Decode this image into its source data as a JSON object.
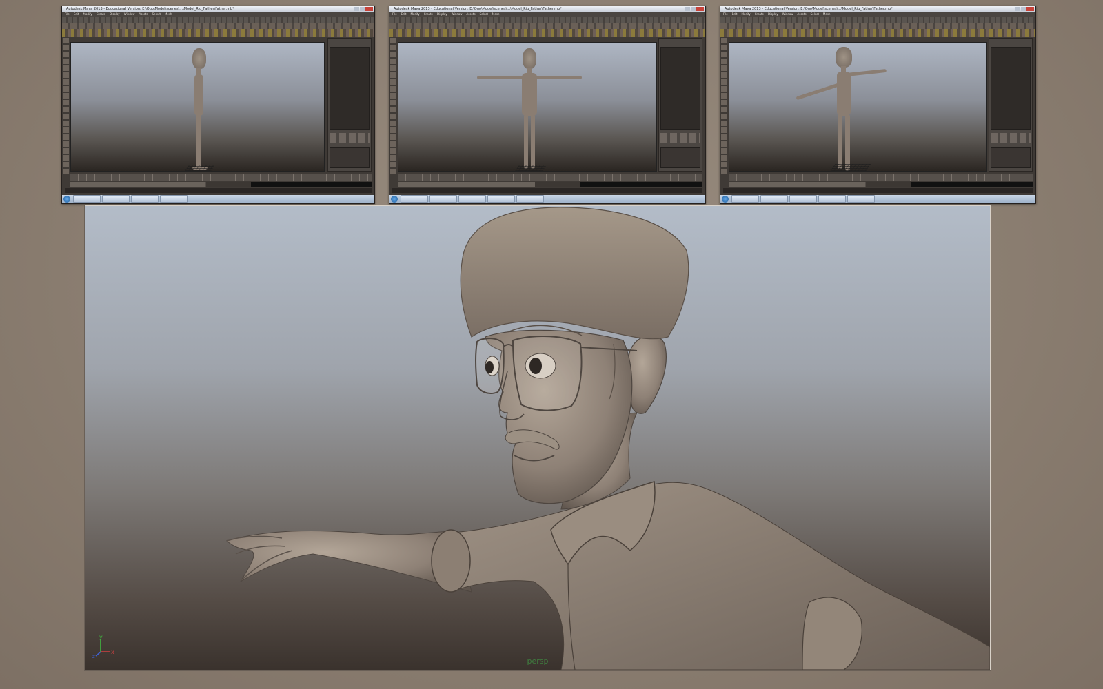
{
  "thumbnails": [
    {
      "title": "Autodesk Maya 2013 - Educational Version: E:\\Ogo\\Model\\scenes\\...\\Model_Rig_Father\\Father.mb*",
      "menu": [
        "File",
        "Edit",
        "Modify",
        "Create",
        "Display",
        "Window",
        "Assets",
        "Select",
        "Mesh",
        "Edit Mesh",
        "Proxy",
        "Normals",
        "Color",
        "Create UVs",
        "Edit UVs",
        "Muscle",
        "Pipeline Cache",
        "Help"
      ],
      "view": "side"
    },
    {
      "title": "Autodesk Maya 2013 - Educational Version: E:\\Ogo\\Model\\scenes\\...\\Model_Rig_Father\\Father.mb*",
      "menu": [
        "File",
        "Edit",
        "Modify",
        "Create",
        "Display",
        "Window",
        "Assets",
        "Select",
        "Mesh",
        "Edit Mesh",
        "Proxy",
        "Normals",
        "Color",
        "Create UVs",
        "Edit UVs",
        "Muscle",
        "Pipeline Cache",
        "Help"
      ],
      "view": "front"
    },
    {
      "title": "Autodesk Maya 2013 - Educational Version: E:\\Ogo\\Model\\scenes\\...\\Model_Rig_Father\\Father.mb*",
      "menu": [
        "File",
        "Edit",
        "Modify",
        "Create",
        "Display",
        "Window",
        "Assets",
        "Select",
        "Mesh",
        "Edit Mesh",
        "Proxy",
        "Normals",
        "Color",
        "Create UVs",
        "Edit UVs",
        "Muscle",
        "Pipeline Cache",
        "Help"
      ],
      "view": "three-quarter"
    }
  ],
  "main_viewport": {
    "camera_label": "persp",
    "axis": {
      "y": "y",
      "x": "x",
      "z": "z"
    }
  },
  "colors": {
    "page_background": "#8b7f72",
    "viewport_top": "#b3bcc8",
    "viewport_bottom": "#3a322d",
    "character_skin": "#8e8176",
    "camera_label": "#3f7e3f"
  }
}
